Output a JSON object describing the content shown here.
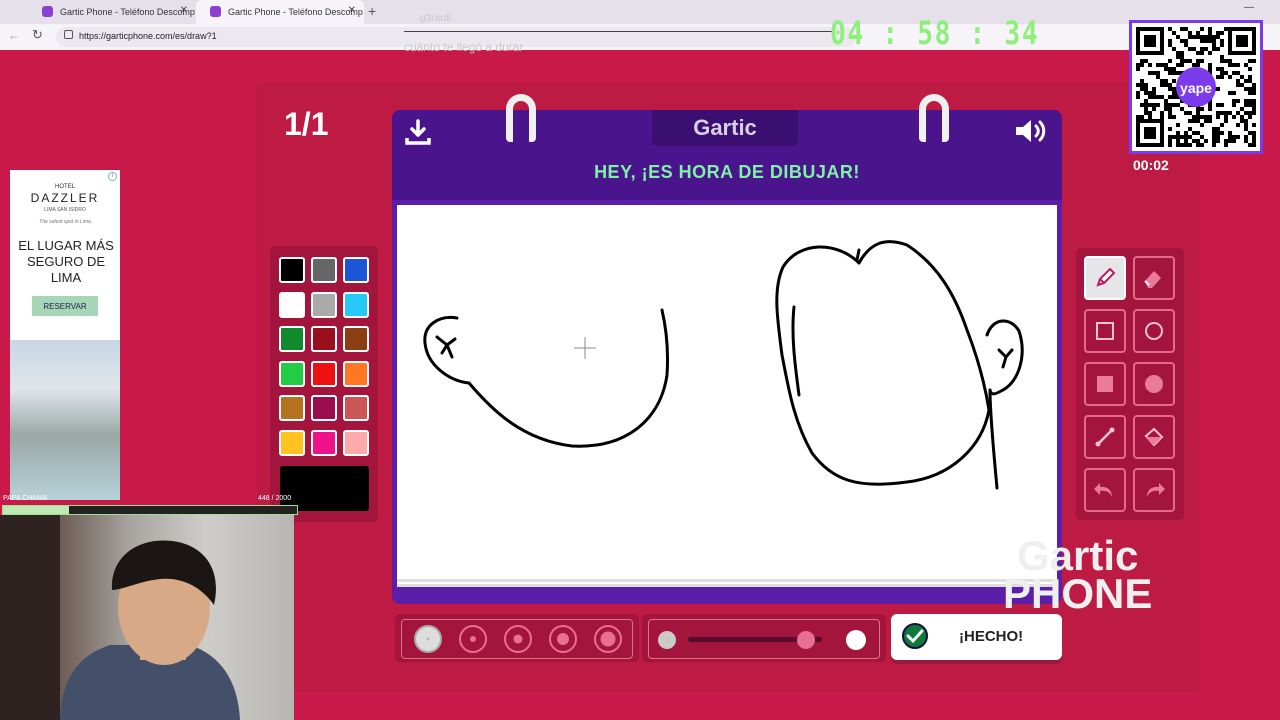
{
  "browser": {
    "tabs": [
      {
        "title": "Gartic Phone - Teléfono Descomp",
        "active": false
      },
      {
        "title": "Gartic Phone - Teléfono Descomp",
        "active": true
      }
    ],
    "url": "https://garticphone.com/es/draw?1"
  },
  "overlay": {
    "name": "g3rardl",
    "caption": "cuánto te llegó a durar",
    "timer": "04 : 58 : 34",
    "qr_label": "00:02",
    "qr_brand": "yape"
  },
  "game": {
    "round": "1/1",
    "logo": "Gartic",
    "title": "HEY, ¡ES HORA DE DIBUJAR!",
    "watermark_line1": "Gartic",
    "watermark_line2": "PHONE",
    "done_label": "¡HECHO!",
    "palette": [
      "#000000",
      "#666666",
      "#1a56d6",
      "#ffffff",
      "#aaaaaa",
      "#26c9f5",
      "#118a2e",
      "#9a0f1c",
      "#8a3e11",
      "#22cc44",
      "#ee1111",
      "#ff7722",
      "#b5721f",
      "#9a0d4e",
      "#cc5555",
      "#ffc21f",
      "#ee1188",
      "#ffaaaa"
    ],
    "current_color": "#000000",
    "tools": [
      "pencil",
      "eraser",
      "rectangle",
      "ellipse",
      "filled-rectangle",
      "filled-ellipse",
      "line",
      "bucket",
      "undo",
      "redo"
    ],
    "brush_sizes": 5,
    "selected_size": 1,
    "opacity": 0.88
  },
  "ad": {
    "hotel": "HOTEL",
    "brand": "DAZZLER",
    "sub": "LIMA SAN ISIDRO",
    "tagline": "The safest spot in Lima",
    "headline": "EL LUGAR MÁS SEGURO DE LIMA",
    "button": "RESERVAR"
  },
  "webcam": {
    "name": "PAPA CHAMA",
    "count": "448  / 2000",
    "progress": 0.224
  }
}
